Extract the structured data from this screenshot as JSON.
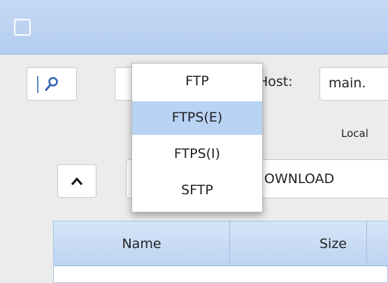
{
  "window": {
    "icon": "window-icon"
  },
  "toolbar": {
    "search_icon": "search-icon",
    "host_label": "Host:",
    "host_value": "main.",
    "local_label": "Local"
  },
  "navigation": {
    "up_icon": "chevron-up-icon",
    "path_value": "OWNLOAD"
  },
  "protocol_menu": {
    "items": [
      {
        "label": "FTP",
        "selected": false
      },
      {
        "label": "FTPS(E)",
        "selected": true
      },
      {
        "label": "FTPS(I)",
        "selected": false
      },
      {
        "label": "SFTP",
        "selected": false
      }
    ]
  },
  "table": {
    "columns": [
      {
        "label": "Name"
      },
      {
        "label": "Size"
      },
      {
        "label": ""
      }
    ],
    "rows": []
  },
  "colors": {
    "titlebar": "#c5d9f4",
    "selection": "#b8d3f3",
    "accent": "#5b86c9"
  }
}
